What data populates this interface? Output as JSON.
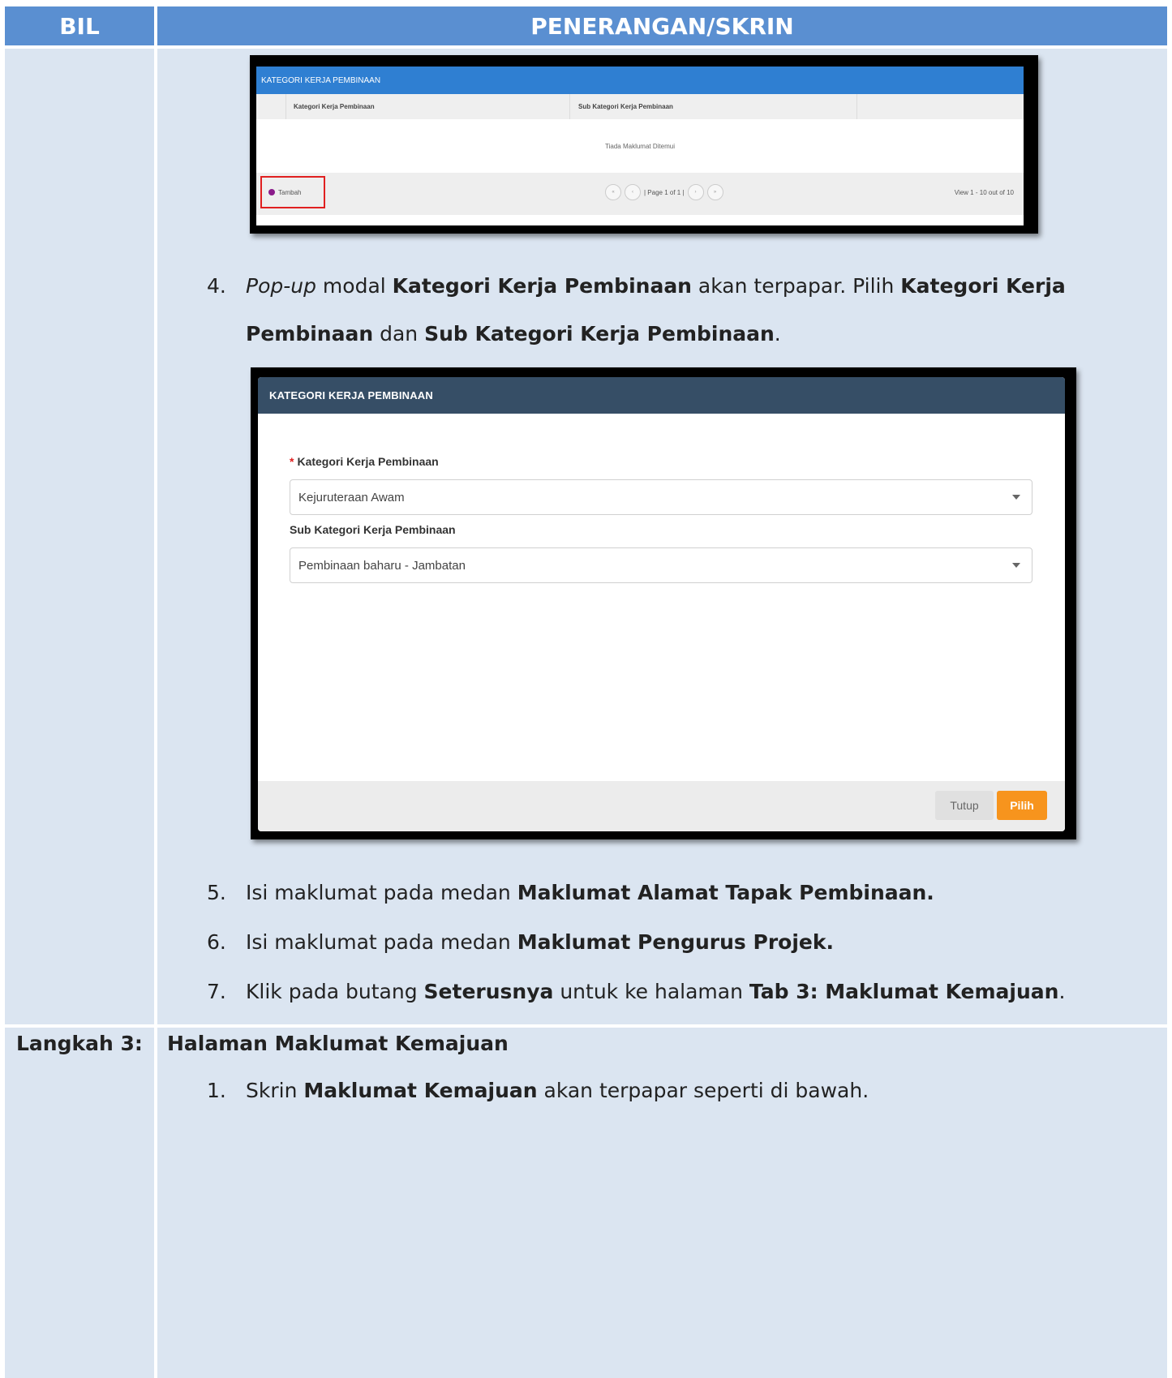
{
  "header": {
    "bil": "BIL",
    "penerangan": "PENERANGAN/SKRIN"
  },
  "shot1": {
    "title": "KATEGORI KERJA PEMBINAAN",
    "col1": "Kategori Kerja Pembinaan",
    "col2": "Sub Kategori Kerja Pembinaan",
    "empty": "Tiada Maklumat Ditemui",
    "tambah": "Tambah",
    "page_text": "| Page 1 of 1 |",
    "view_count": "View 1 - 10 out of 10"
  },
  "step4": {
    "num": "4.",
    "t1": "Pop-up",
    "t2": " modal ",
    "b1": "Kategori Kerja Pembinaan",
    "t3": " akan terpapar. Pilih ",
    "b2": "Kategori Kerja",
    "b3": "Pembinaan",
    "t4": " dan ",
    "b4": "Sub Kategori Kerja Pembinaan",
    "t5": "."
  },
  "modal": {
    "title": "KATEGORI KERJA PEMBINAAN",
    "label1": "Kategori Kerja Pembinaan",
    "value1": "Kejuruteraan Awam",
    "label2": "Sub Kategori Kerja Pembinaan",
    "value2": "Pembinaan baharu - Jambatan",
    "close_label": "Tutup",
    "select_label": "Pilih"
  },
  "step5": {
    "num": "5.",
    "t1": "Isi maklumat pada medan ",
    "b1": "Maklumat Alamat Tapak Pembinaan."
  },
  "step6": {
    "num": "6.",
    "t1": "Isi maklumat pada medan ",
    "b1": "Maklumat Pengurus Projek."
  },
  "step7": {
    "num": "7.",
    "t1": "Klik pada butang ",
    "b1": "Seterusnya",
    "t2": " untuk ke halaman ",
    "b2": "Tab 3: Maklumat Kemajuan",
    "t3": "."
  },
  "langkah3": {
    "label": "Langkah 3:",
    "title": "Halaman Maklumat Kemajuan"
  },
  "step3_1": {
    "num": "1.",
    "t1": "Skrin ",
    "b1": "Maklumat Kemajuan",
    "t2": " akan terpapar seperti di bawah."
  }
}
